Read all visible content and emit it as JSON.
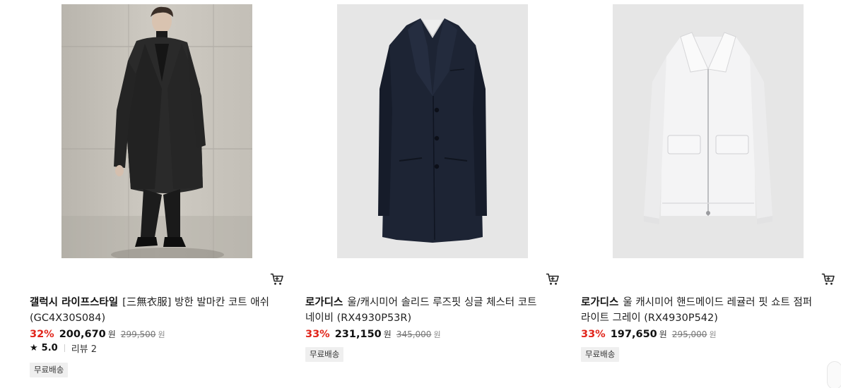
{
  "products": [
    {
      "brand": "갤럭시 라이프스타일",
      "name": "[三無衣服] 방한 발마칸 코트 애쉬 (GC4X30S084)",
      "discount": "32%",
      "sale_price": "200,670",
      "sale_unit": "원",
      "original_price": "299,500",
      "original_unit": "원",
      "rating_score": "5.0",
      "review_text": "리뷰 2",
      "badge": "무료배송",
      "image_icon": "model-coat-photo",
      "cart_icon": "cart-icon"
    },
    {
      "brand": "로가디스",
      "name": "울/캐시미어 솔리드 루즈핏 싱글 체스터 코트 네이비 (RX4930P53R)",
      "discount": "33%",
      "sale_price": "231,150",
      "sale_unit": "원",
      "original_price": "345,000",
      "original_unit": "원",
      "badge": "무료배송",
      "image_icon": "navy-coat-photo",
      "cart_icon": "cart-icon"
    },
    {
      "brand": "로가디스",
      "name": "울 캐시미어 핸드메이드 레귤러 핏 쇼트 점퍼 라이트 그레이 (RX4930P542)",
      "discount": "33%",
      "sale_price": "197,650",
      "sale_unit": "원",
      "original_price": "295,000",
      "original_unit": "원",
      "badge": "무료배송",
      "image_icon": "grey-jacket-photo",
      "cart_icon": "cart-icon"
    }
  ],
  "colors": {
    "discount": "#e1251b",
    "badge_bg": "#efefef",
    "text": "#111111",
    "muted": "#777777"
  }
}
